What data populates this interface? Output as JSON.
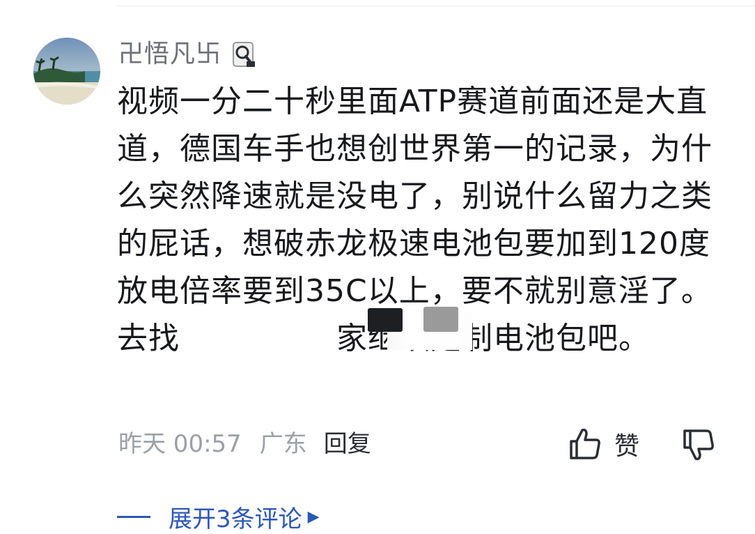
{
  "comment": {
    "username": "卍悟凡卐",
    "text": "视频一分二十秒里面ATP赛道前面还是大直道，德国车手也想创世界第一的记录，为什么突然降速就是没电了，别说什么留力之类的屁话，想破赤龙极速电池包要加到120度放电倍率要到35C以上，要不就别意淫了。去找　　　　　家继续定制电池包吧。",
    "time": "昨天 00:57",
    "location": "广东",
    "reply_label": "回复",
    "like_label": "赞",
    "expand_label": "展开3条评论"
  },
  "icons": {
    "avatar": "avatar-beach-island",
    "badge": "magnifier-badge-icon",
    "like": "thumbs-up-icon",
    "dislike": "thumbs-down-icon",
    "expand": "triangle-right-icon"
  },
  "colors": {
    "username": "#6c7078",
    "text": "#16181c",
    "meta": "#9aa0a6",
    "accent": "#2c57b8"
  }
}
